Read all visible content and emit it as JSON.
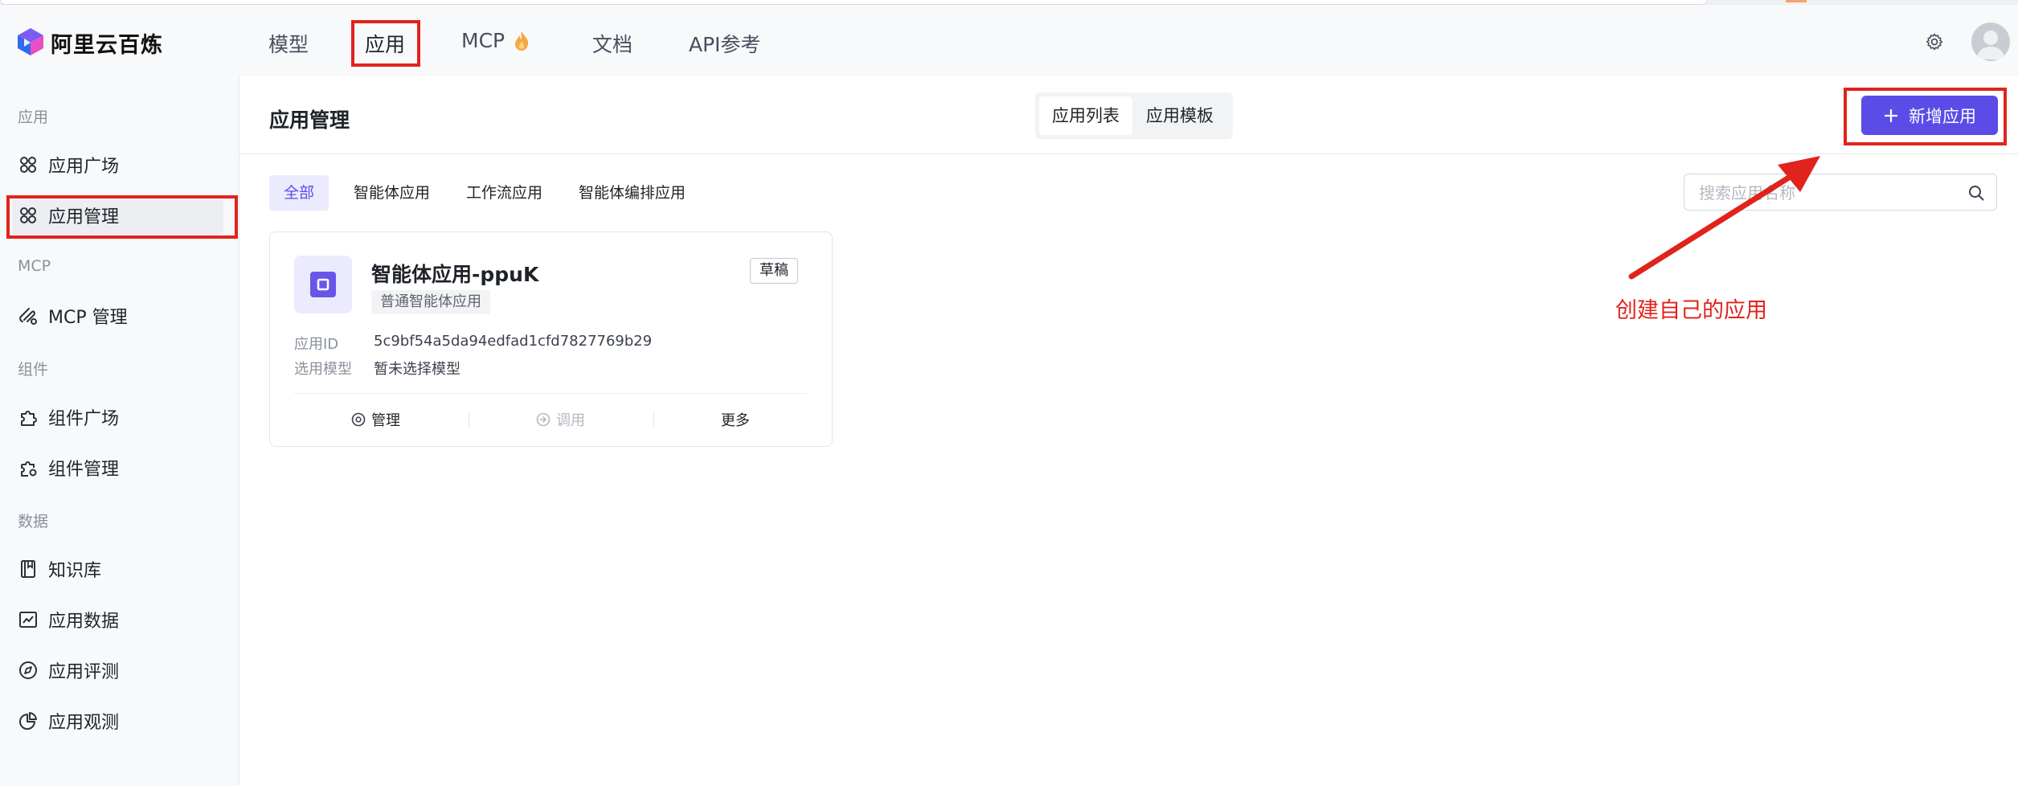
{
  "brand": {
    "name": "阿里云百炼"
  },
  "topnav": {
    "items": [
      "模型",
      "应用",
      "MCP",
      "文档",
      "API参考"
    ],
    "active": "应用"
  },
  "sidebar": {
    "sections": [
      {
        "title": "应用",
        "items": [
          {
            "label": "应用广场",
            "icon": "app-grid-icon"
          },
          {
            "label": "应用管理",
            "icon": "app-grid-icon",
            "active": true
          }
        ]
      },
      {
        "title": "MCP",
        "items": [
          {
            "label": "MCP 管理",
            "icon": "mcp-icon"
          }
        ]
      },
      {
        "title": "组件",
        "items": [
          {
            "label": "组件广场",
            "icon": "puzzle-icon"
          },
          {
            "label": "组件管理",
            "icon": "puzzle-gear-icon"
          }
        ]
      },
      {
        "title": "数据",
        "items": [
          {
            "label": "知识库",
            "icon": "book-icon"
          },
          {
            "label": "应用数据",
            "icon": "chart-icon"
          },
          {
            "label": "应用评测",
            "icon": "compass-icon"
          },
          {
            "label": "应用观测",
            "icon": "pie-icon"
          }
        ]
      }
    ]
  },
  "header": {
    "title": "应用管理",
    "tabs": [
      "应用列表",
      "应用模板"
    ],
    "active_tab": "应用列表",
    "add_button": "新增应用"
  },
  "filters": {
    "items": [
      "全部",
      "智能体应用",
      "工作流应用",
      "智能体编排应用"
    ],
    "active": "全部"
  },
  "search": {
    "placeholder": "搜索应用名称",
    "value": ""
  },
  "apps": [
    {
      "name": "智能体应用-ppuK",
      "type": "普通智能体应用",
      "status": "草稿",
      "id_label": "应用ID",
      "id": "5c9bf54a5da94edfad1cfd7827769b29",
      "model_label": "选用模型",
      "model": "暂未选择模型",
      "actions": {
        "manage": "管理",
        "invoke": "调用",
        "more": "更多"
      }
    }
  ],
  "annotation": {
    "text": "创建自己的应用",
    "color": "#e0231c"
  },
  "colors": {
    "accent": "#5b4ce8",
    "annotation": "#e0231c"
  }
}
